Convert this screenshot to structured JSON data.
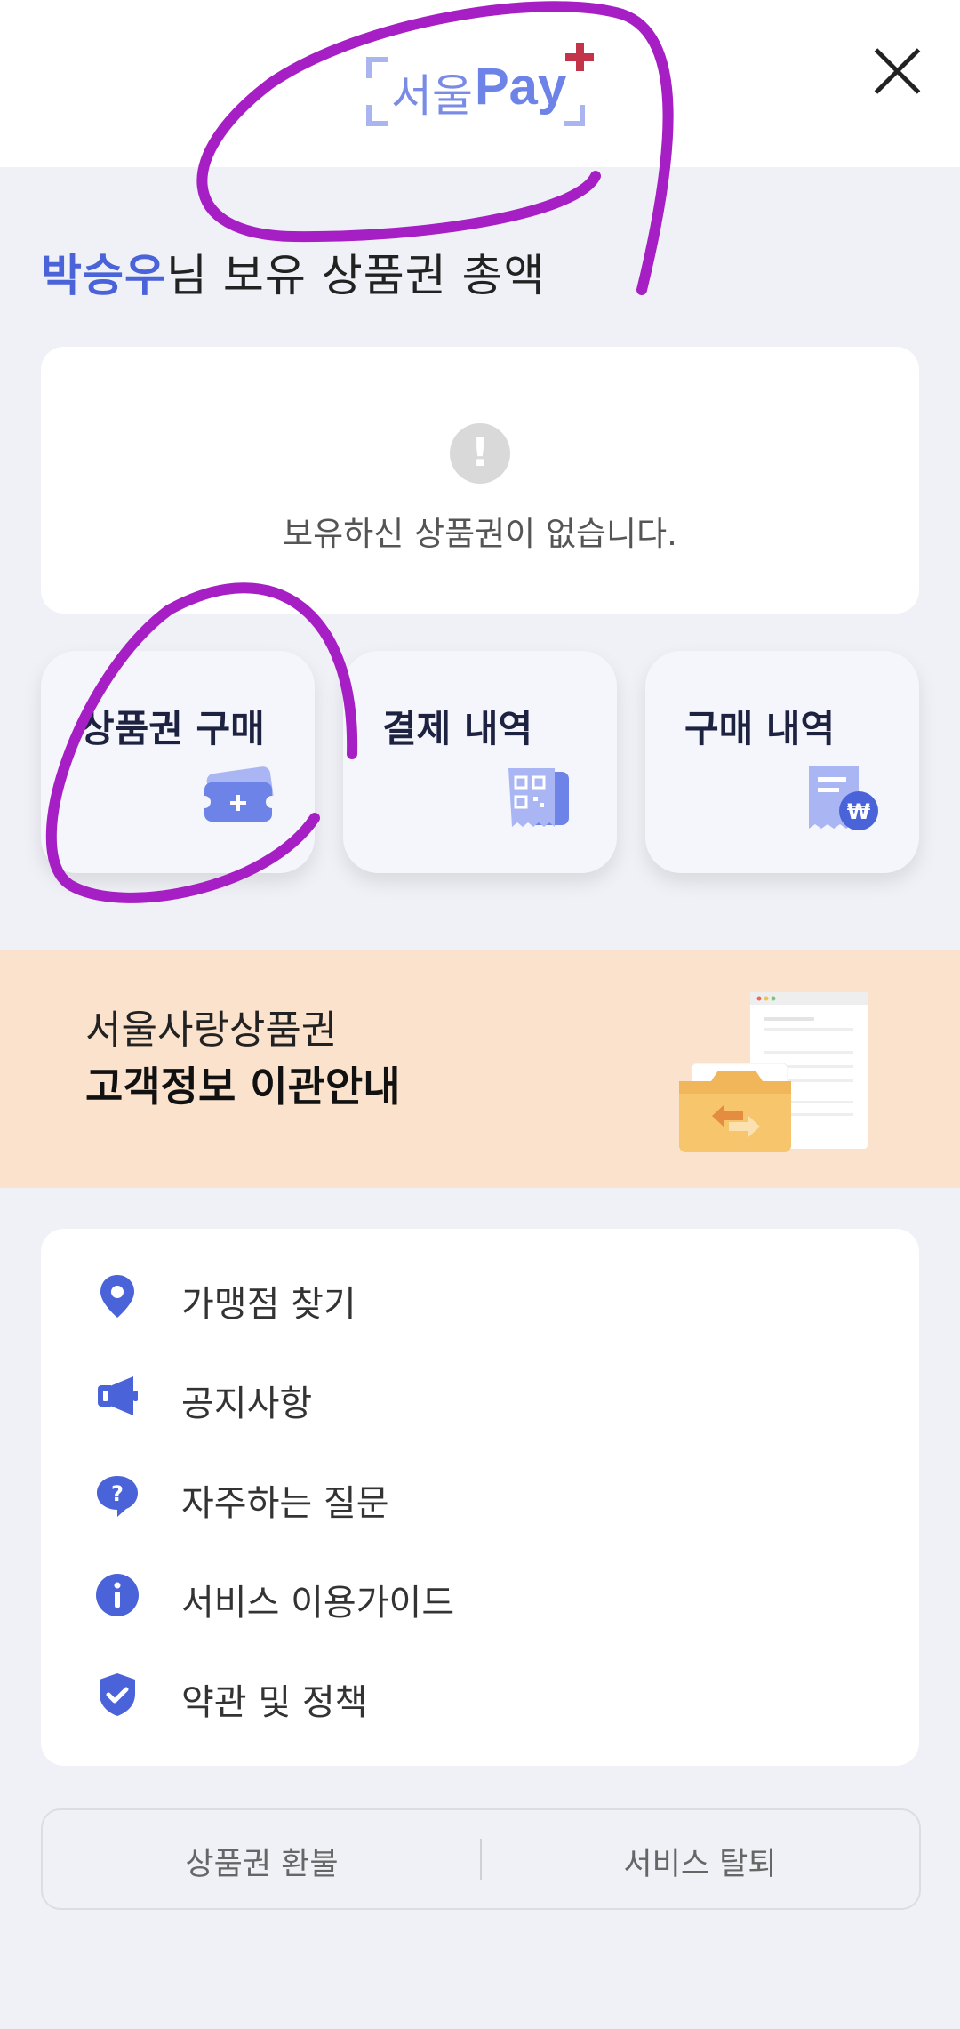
{
  "header": {
    "logo_kr": "서울",
    "logo_en": "Pay",
    "close_label": "×"
  },
  "title": {
    "name": "박승우",
    "suffix": "님 보유 상품권 총액"
  },
  "balance": {
    "alert_glyph": "!",
    "empty_text": "보유하신 상품권이 없습니다."
  },
  "actions": [
    {
      "label": "상품권 구매",
      "icon": "ticket-plus-icon"
    },
    {
      "label": "결제 내역",
      "icon": "qr-receipt-icon"
    },
    {
      "label": "구매 내역",
      "icon": "won-receipt-icon"
    }
  ],
  "banner": {
    "line1": "서울사랑상품권",
    "line2": "고객정보 이관안내"
  },
  "menu": [
    {
      "label": "가맹점 찾기",
      "icon": "map-pin-icon"
    },
    {
      "label": "공지사항",
      "icon": "megaphone-icon"
    },
    {
      "label": "자주하는 질문",
      "icon": "question-bubble-icon"
    },
    {
      "label": "서비스 이용가이드",
      "icon": "info-icon"
    },
    {
      "label": "약관 및 정책",
      "icon": "shield-check-icon"
    }
  ],
  "footer": {
    "refund": "상품권 환불",
    "withdraw": "서비스 탈퇴"
  },
  "colors": {
    "accent": "#4a63d8",
    "background": "#f0f1f6",
    "banner": "#fae2cc",
    "annotation": "#a61fc4"
  }
}
